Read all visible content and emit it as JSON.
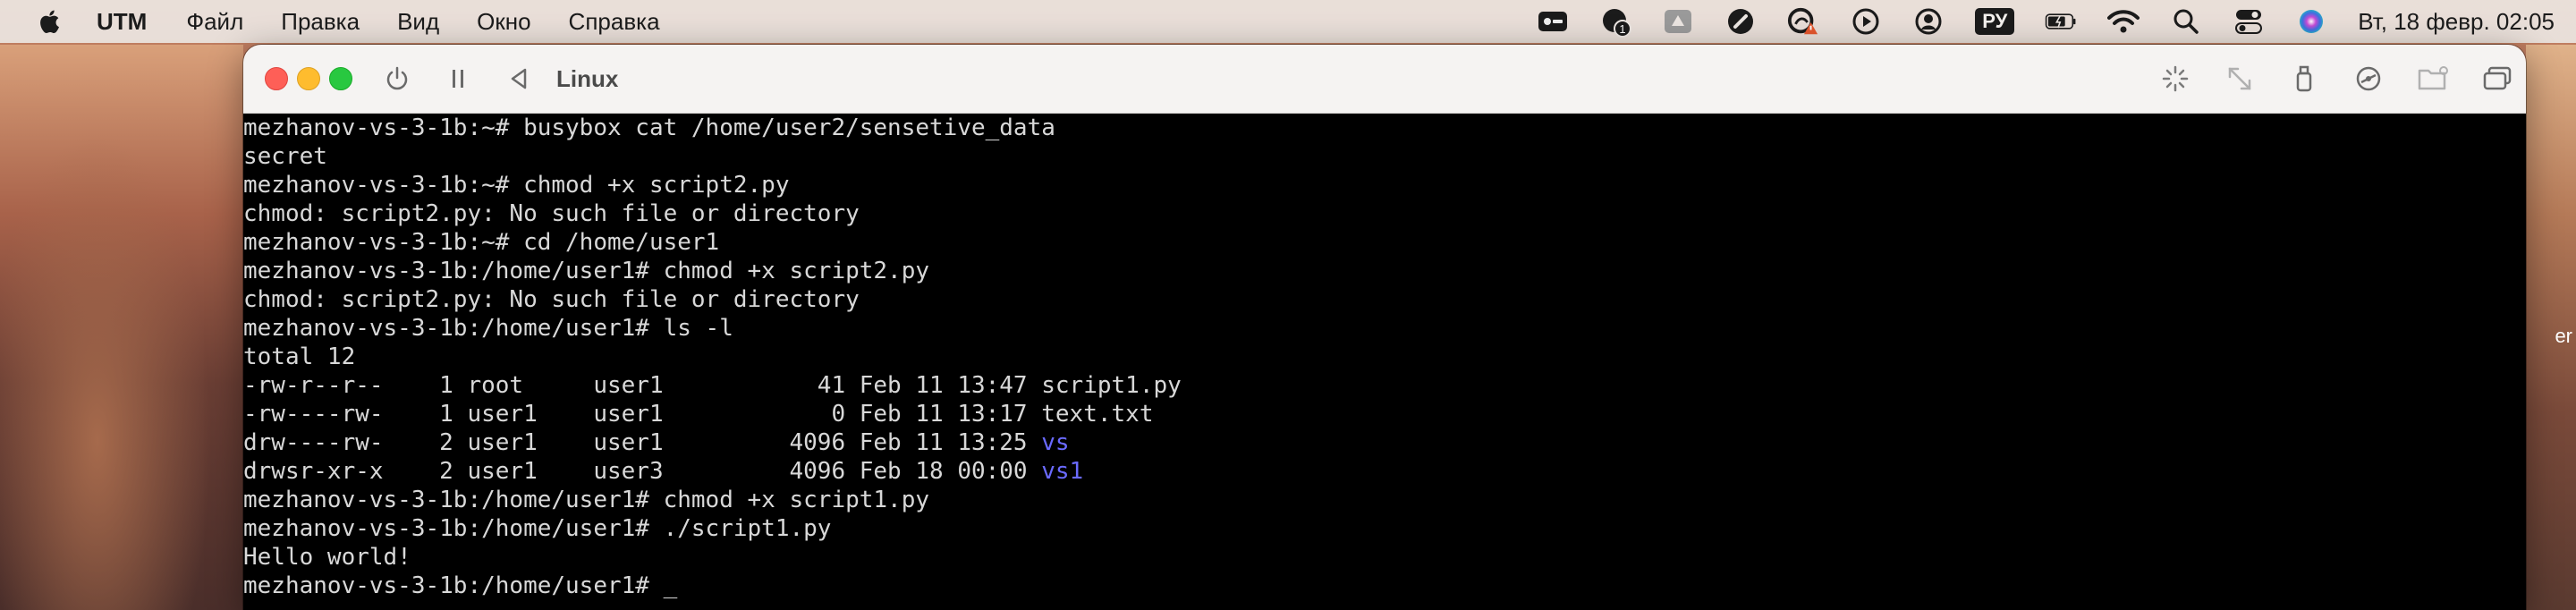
{
  "menubar": {
    "app_name": "UTM",
    "items": [
      "Файл",
      "Правка",
      "Вид",
      "Окно",
      "Справка"
    ],
    "tray_icons": [
      "keyboard-icon",
      "notification-icon",
      "drive-icon",
      "speed-icon",
      "cloud-warning-icon",
      "play-icon",
      "user-icon",
      "battery-icon",
      "wifi-icon",
      "search-icon",
      "control-center-icon",
      "siri-icon"
    ],
    "notification_count": "1",
    "input_language": "РУ",
    "clock": "Вт, 18 февр.  02:05"
  },
  "window": {
    "title": "Linux",
    "toolbar_left": [
      "power-icon",
      "pause-icon",
      "back-icon"
    ],
    "toolbar_right": [
      "capture-mouse-icon",
      "resize-icon",
      "usb-icon",
      "drive-icon",
      "shared-folder-icon",
      "windows-icon"
    ]
  },
  "desktop": {
    "partial_label": "er"
  },
  "terminal": {
    "lines": [
      "mezhanov-vs-3-1b:~# busybox cat /home/user2/sensetive_data",
      "secret",
      "mezhanov-vs-3-1b:~# chmod +x script2.py",
      "chmod: script2.py: No such file or directory",
      "mezhanov-vs-3-1b:~# cd /home/user1",
      "mezhanov-vs-3-1b:/home/user1# chmod +x script2.py",
      "chmod: script2.py: No such file or directory",
      "mezhanov-vs-3-1b:/home/user1# ls -l",
      "total 12",
      "-rw-r--r--    1 root     user1           41 Feb 11 13:47 script1.py",
      "-rw----rw-    1 user1    user1            0 Feb 11 13:17 text.txt",
      "drw----rw-    2 user1    user1         4096 Feb 11 13:25 ",
      "drwsr-xr-x    2 user1    user3         4096 Feb 18 00:00 ",
      "mezhanov-vs-3-1b:/home/user1# chmod +x script1.py",
      "mezhanov-vs-3-1b:/home/user1# ./script1.py",
      "Hello world!",
      "mezhanov-vs-3-1b:/home/user1# "
    ],
    "dir_names": [
      "vs",
      "vs1"
    ],
    "cursor": "_",
    "colors": {
      "background": "#000000",
      "text": "#d8d8d8",
      "directory": "#6a6aff"
    }
  }
}
